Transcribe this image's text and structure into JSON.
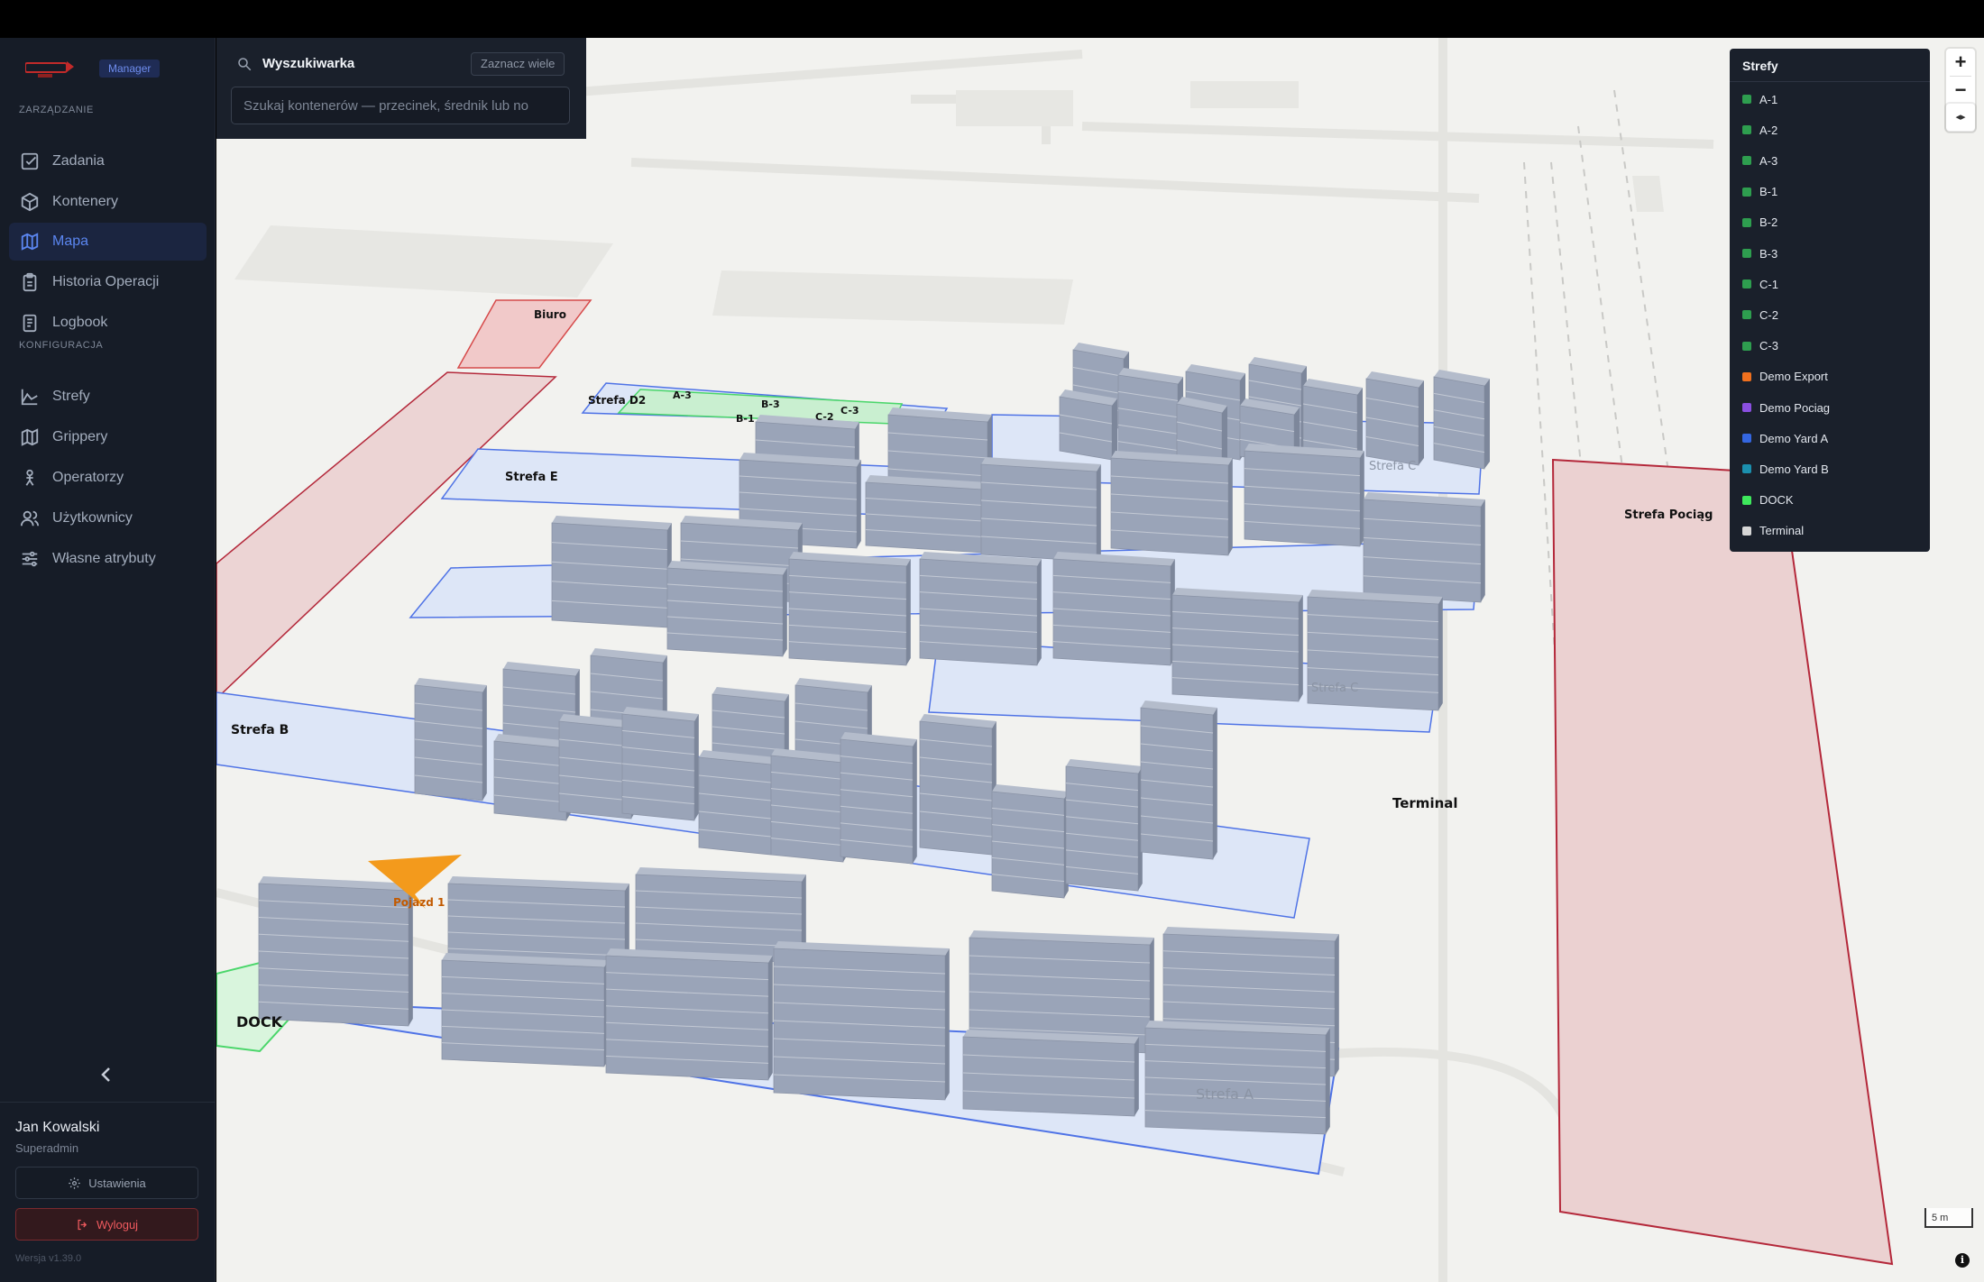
{
  "sidebar": {
    "role_badge": "Manager",
    "section_management": "ZARZĄDZANIE",
    "section_config": "KONFIGURACJA",
    "nav_management": [
      {
        "label": "Zadania",
        "icon": "checkbox-icon"
      },
      {
        "label": "Kontenery",
        "icon": "box-icon"
      },
      {
        "label": "Mapa",
        "icon": "map-icon",
        "active": true
      },
      {
        "label": "Historia Operacji",
        "icon": "clipboard-icon"
      },
      {
        "label": "Logbook",
        "icon": "notebook-icon"
      }
    ],
    "nav_config": [
      {
        "label": "Strefy",
        "icon": "area-chart-icon"
      },
      {
        "label": "Grippery",
        "icon": "map-icon"
      },
      {
        "label": "Operatorzy",
        "icon": "person-icon"
      },
      {
        "label": "Użytkownicy",
        "icon": "users-icon"
      },
      {
        "label": "Własne atrybuty",
        "icon": "sliders-icon"
      }
    ],
    "user": {
      "name": "Jan Kowalski",
      "role": "Superadmin"
    },
    "settings_label": "Ustawienia",
    "logout_label": "Wyloguj",
    "version": "Wersja v1.39.0"
  },
  "search": {
    "title": "Wyszukiwarka",
    "multi_select_label": "Zaznacz wiele",
    "placeholder": "Szukaj kontenerów — przecinek, średnik lub no"
  },
  "zones_legend": {
    "title": "Strefy",
    "items": [
      {
        "label": "A-1",
        "color": "#2e9e4f"
      },
      {
        "label": "A-2",
        "color": "#2e9e4f"
      },
      {
        "label": "A-3",
        "color": "#2e9e4f"
      },
      {
        "label": "B-1",
        "color": "#2e9e4f"
      },
      {
        "label": "B-2",
        "color": "#2e9e4f"
      },
      {
        "label": "B-3",
        "color": "#2e9e4f"
      },
      {
        "label": "C-1",
        "color": "#2e9e4f"
      },
      {
        "label": "C-2",
        "color": "#2e9e4f"
      },
      {
        "label": "C-3",
        "color": "#2e9e4f"
      },
      {
        "label": "Demo Export",
        "color": "#f0701e"
      },
      {
        "label": "Demo Pociag",
        "color": "#8a4fe0"
      },
      {
        "label": "Demo Yard A",
        "color": "#3466e0"
      },
      {
        "label": "Demo Yard B",
        "color": "#1b8fae"
      },
      {
        "label": "DOCK",
        "color": "#3ee85c"
      },
      {
        "label": "Terminal",
        "color": "#d6d6d6"
      }
    ]
  },
  "map": {
    "labels": {
      "biuro": "Biuro",
      "strefa_d2": "Strefa D2",
      "a3": "A-3",
      "b3": "B-3",
      "b1": "B-1",
      "c2": "C-2",
      "c3": "C-3",
      "strefa_e": "Strefa E",
      "strefa_b": "Strefa B",
      "strefa_pociag": "Strefa Pociąg",
      "terminal": "Terminal",
      "dock": "DOCK",
      "vehicle": "Pojazd 1",
      "strefa_a": "Strefa A",
      "strefa_c": "Strefa C",
      "strefa_c_top": "Strefa C"
    },
    "scale": "5 m",
    "zoom_in": "+",
    "zoom_out": "−",
    "compass": "◂▸",
    "info": "i"
  },
  "colors": {
    "zone_blue": "#4f73e6",
    "zone_red": "#b4283a",
    "zone_green": "#4ad66a",
    "container": "#9aa4b8",
    "vehicle": "#f39a1c"
  }
}
